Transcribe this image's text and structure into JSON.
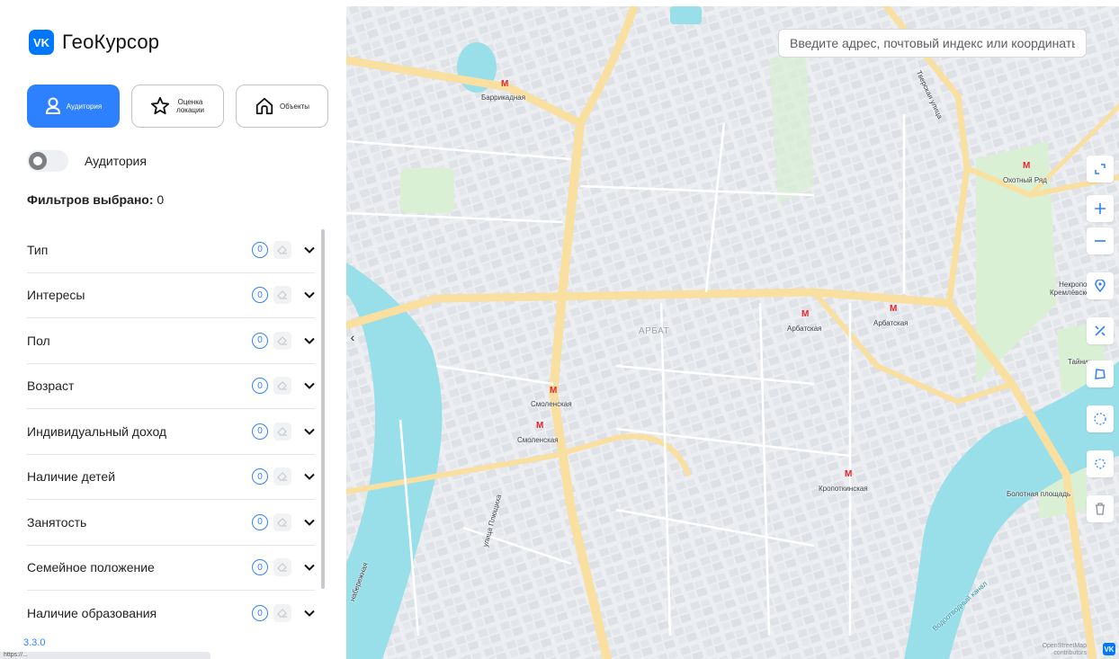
{
  "app": {
    "logo_mark": "VK",
    "title": "ГеоКурсор",
    "version": "3.3.0"
  },
  "modes": [
    {
      "label": "Аудитория",
      "icon": "user-icon",
      "active": true
    },
    {
      "label": "Оценка локации",
      "icon": "star-icon",
      "active": false
    },
    {
      "label": "Объекты",
      "icon": "home-icon",
      "active": false
    }
  ],
  "toggle": {
    "label": "Аудитория",
    "on": false
  },
  "filters": {
    "selected_label": "Фильтров выбрано:",
    "selected_count": "0",
    "items": [
      {
        "name": "Тип",
        "count": "0"
      },
      {
        "name": "Интересы",
        "count": "0"
      },
      {
        "name": "Пол",
        "count": "0"
      },
      {
        "name": "Возраст",
        "count": "0"
      },
      {
        "name": "Индивидуальный доход",
        "count": "0"
      },
      {
        "name": "Наличие детей",
        "count": "0"
      },
      {
        "name": "Занятость",
        "count": "0"
      },
      {
        "name": "Семейное положение",
        "count": "0"
      },
      {
        "name": "Наличие образования",
        "count": "0"
      }
    ]
  },
  "status_url": "https://...",
  "search": {
    "placeholder": "Введите адрес, почтовый индекс или координаты",
    "value": ""
  },
  "map": {
    "district": "АРБАТ",
    "stations": [
      "Баррикадная",
      "Охотный Ряд",
      "Арбатская",
      "Арбатская",
      "Смоленская",
      "Смоленская",
      "Кропоткинская"
    ],
    "places": [
      "Некропол Кремлёвской",
      "Тайниц",
      "Болотная площадь"
    ],
    "streets": [
      "Тверская улица",
      "улица Плющиха",
      "Водоотводный канал",
      "набережная"
    ],
    "attribution": "OpenStreetMap contributors",
    "corner_logo": "VK"
  },
  "tools": [
    "fullscreen-icon",
    "zoom-in-icon",
    "zoom-out-icon",
    "location-icon",
    "ruler-icon",
    "polygon-icon",
    "circle-draw-icon",
    "lasso-icon",
    "trash-icon"
  ],
  "colors": {
    "accent": "#2D81FF",
    "brand": "#0077FF",
    "water": "#98DFEA",
    "road": "#F9DFA0",
    "park": "#D9F0D4",
    "metro": "#E8262B"
  }
}
